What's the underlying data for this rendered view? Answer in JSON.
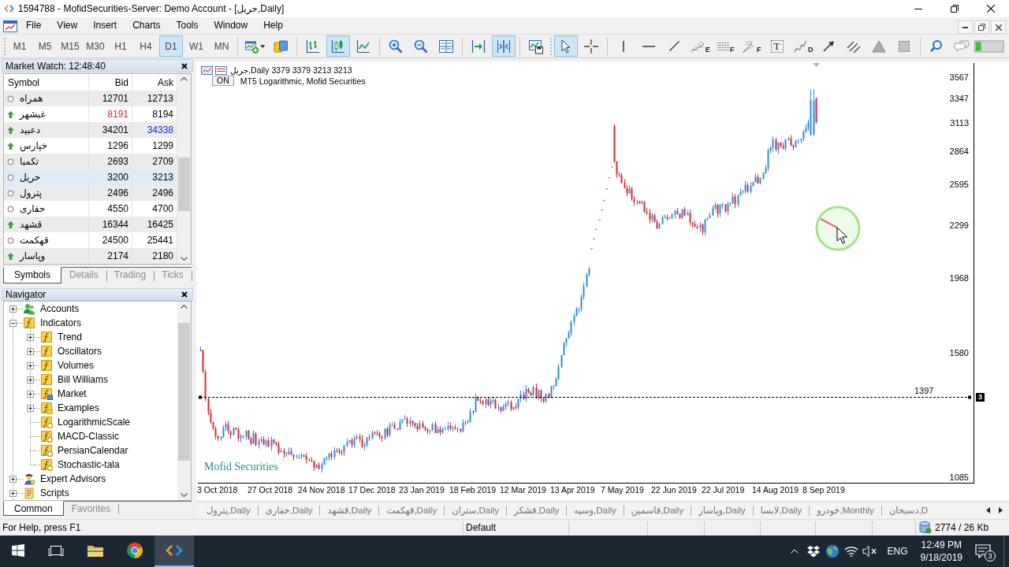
{
  "window": {
    "title": "1594788 - MofidSecurities-Server: Demo Account - [حریل,Daily]"
  },
  "menu": [
    "File",
    "View",
    "Insert",
    "Charts",
    "Tools",
    "Window",
    "Help"
  ],
  "toolbar": {
    "timeframes": [
      {
        "label": "M1",
        "selected": false
      },
      {
        "label": "M5",
        "selected": false
      },
      {
        "label": "M15",
        "selected": false
      },
      {
        "label": "M30",
        "selected": false
      },
      {
        "label": "H1",
        "selected": false
      },
      {
        "label": "H4",
        "selected": false
      },
      {
        "label": "D1",
        "selected": true
      },
      {
        "label": "W1",
        "selected": false
      },
      {
        "label": "MN",
        "selected": false
      }
    ],
    "tool_groups": [
      [
        {
          "kind": "new-chart",
          "selected": false
        },
        {
          "kind": "profiles",
          "selected": false
        }
      ],
      [
        {
          "kind": "bar-chart",
          "selected": false
        },
        {
          "kind": "candlesticks",
          "selected": true
        },
        {
          "kind": "line-chart",
          "selected": false
        }
      ],
      [
        {
          "kind": "zoom-in",
          "selected": false
        },
        {
          "kind": "zoom-out",
          "selected": false
        },
        {
          "kind": "tile",
          "selected": false
        }
      ],
      [
        {
          "kind": "chart-shift",
          "selected": false
        },
        {
          "kind": "auto-scroll",
          "selected": true
        }
      ],
      [
        {
          "kind": "templates",
          "selected": false
        }
      ],
      [
        {
          "kind": "cursor",
          "selected": true
        },
        {
          "kind": "crosshair",
          "selected": false
        }
      ],
      [
        {
          "kind": "vertical-line",
          "selected": false
        },
        {
          "kind": "horizontal-line",
          "selected": false
        },
        {
          "kind": "trendline",
          "selected": false
        },
        {
          "kind": "fibo-expansion",
          "selected": false,
          "letter": "E"
        },
        {
          "kind": "fibo-retracement",
          "selected": false,
          "letter": "F"
        },
        {
          "kind": "fibo-fan",
          "selected": false,
          "letter": "F"
        },
        {
          "kind": "text-label",
          "selected": false,
          "letter": "T"
        },
        {
          "kind": "wave",
          "selected": false,
          "letter": "D"
        },
        {
          "kind": "arrow",
          "selected": false
        },
        {
          "kind": "channel",
          "selected": false
        },
        {
          "kind": "triangle",
          "selected": false
        },
        {
          "kind": "rectangle",
          "selected": false
        }
      ],
      [
        {
          "kind": "search",
          "selected": false
        },
        {
          "kind": "chat",
          "selected": false
        }
      ]
    ]
  },
  "market_watch": {
    "title": "Market Watch: 12:48:40",
    "columns": [
      "Symbol",
      "Bid",
      "Ask"
    ],
    "rows": [
      {
        "symbol": "همراه",
        "kind": "unchanged",
        "bid": "12701",
        "ask": "12713",
        "bid_down": false,
        "ask_up": false,
        "selected": false
      },
      {
        "symbol": "غبشهر",
        "kind": "rising",
        "bid": "8191",
        "ask": "8194",
        "bid_down": true,
        "ask_up": false,
        "selected": false
      },
      {
        "symbol": "دعبید",
        "kind": "rising",
        "bid": "34201",
        "ask": "34338",
        "bid_down": false,
        "ask_up": true,
        "selected": false
      },
      {
        "symbol": "خپارس",
        "kind": "rising",
        "bid": "1296",
        "ask": "1299",
        "bid_down": false,
        "ask_up": false,
        "selected": false
      },
      {
        "symbol": "تکمبا",
        "kind": "unchanged",
        "bid": "2693",
        "ask": "2709",
        "bid_down": false,
        "ask_up": false,
        "selected": false
      },
      {
        "symbol": "حریل",
        "kind": "unchanged",
        "bid": "3200",
        "ask": "3213",
        "bid_down": false,
        "ask_up": false,
        "selected": true
      },
      {
        "symbol": "پترول",
        "kind": "unchanged",
        "bid": "2496",
        "ask": "2496",
        "bid_down": false,
        "ask_up": false,
        "selected": false
      },
      {
        "symbol": "حفاری",
        "kind": "unchanged",
        "bid": "4550",
        "ask": "4700",
        "bid_down": false,
        "ask_up": false,
        "selected": false
      },
      {
        "symbol": "قشهد",
        "kind": "rising",
        "bid": "16344",
        "ask": "16425",
        "bid_down": false,
        "ask_up": false,
        "selected": false
      },
      {
        "symbol": "قهکمت",
        "kind": "unchanged",
        "bid": "24500",
        "ask": "25441",
        "bid_down": false,
        "ask_up": false,
        "selected": false
      },
      {
        "symbol": "وپاسار",
        "kind": "rising",
        "bid": "2174",
        "ask": "2180",
        "bid_down": false,
        "ask_up": false,
        "selected": false
      }
    ],
    "tabs": [
      {
        "label": "Symbols",
        "selected": true
      },
      {
        "label": "Details",
        "selected": false
      },
      {
        "label": "Trading",
        "selected": false
      },
      {
        "label": "Ticks",
        "selected": false
      }
    ]
  },
  "navigator": {
    "title": "Navigator",
    "items": [
      {
        "label": "Accounts",
        "kind": "accounts",
        "expanded": false
      },
      {
        "label": "Indicators",
        "kind": "indicators",
        "expanded": true,
        "children": [
          {
            "label": "Trend",
            "kind": "indicators",
            "expanded": false
          },
          {
            "label": "Oscillators",
            "kind": "indicators",
            "expanded": false
          },
          {
            "label": "Volumes",
            "kind": "indicators",
            "expanded": false
          },
          {
            "label": "Bill Williams",
            "kind": "indicators",
            "expanded": false
          },
          {
            "label": "Market",
            "kind": "market",
            "expanded": false
          },
          {
            "label": "Examples",
            "kind": "examples",
            "expanded": false
          },
          {
            "label": "LogarithmicScale",
            "kind": "custom"
          },
          {
            "label": "MACD-Classic",
            "kind": "custom"
          },
          {
            "label": "PersianCalendar",
            "kind": "custom"
          },
          {
            "label": "Stochastic-tala",
            "kind": "custom"
          }
        ]
      },
      {
        "label": "Expert Advisors",
        "kind": "experts",
        "expanded": false
      },
      {
        "label": "Scripts",
        "kind": "scripts",
        "expanded": false
      }
    ],
    "tabs": [
      {
        "label": "Common",
        "selected": true
      },
      {
        "label": "Favorites",
        "selected": false
      }
    ]
  },
  "chart": {
    "symbol_period": "حریل,Daily",
    "ohlc": "3379 3379 3213 3213",
    "indicator_toggle": "ON",
    "indicator_label": "MT5 Logarithmic, Mofid Securities",
    "broker_label": "Mofid Securities",
    "price_labels": [
      "3567",
      "3347",
      "3113",
      "2864",
      "2595",
      "2299",
      "1968",
      "1580",
      "1085"
    ],
    "time_labels": [
      "3 Oct 2018",
      "27 Oct 2018",
      "24 Nov 2018",
      "17 Dec 2018",
      "23 Jan 2019",
      "18 Feb 2019",
      "12 Mar 2019",
      "13 Apr 2019",
      "7 May 2019",
      "22 Jun 2019",
      "22 Jul 2019",
      "14 Aug 2019",
      "8 Sep 2019"
    ],
    "price_line": {
      "label": "1397",
      "marker": "3"
    }
  },
  "chart_tabs": {
    "tabs": [
      {
        "label": "پترول,Daily",
        "selected": false
      },
      {
        "label": "حفاری,Daily",
        "selected": false
      },
      {
        "label": "قشهد,Daily",
        "selected": false
      },
      {
        "label": "قهکمت,Daily",
        "selected": false
      },
      {
        "label": "ستران,Daily",
        "selected": false
      },
      {
        "label": "قشکر,Daily",
        "selected": false
      },
      {
        "label": "وسپه,Daily",
        "selected": false
      },
      {
        "label": "فاسمین,Daily",
        "selected": false
      },
      {
        "label": "وپاسار,Daily",
        "selected": false
      },
      {
        "label": "لابسا,Daily",
        "selected": false
      },
      {
        "label": "خودرو,Monthly",
        "selected": false
      },
      {
        "label": "دسبحان,D",
        "selected": false
      }
    ]
  },
  "status_bar": {
    "help": "For Help, press F1",
    "profile": "Default",
    "traffic": "2774 / 26 Kb"
  },
  "taskbar": {
    "apps": [
      {
        "kind": "file-explorer",
        "active": false
      },
      {
        "kind": "browser",
        "active": false
      },
      {
        "kind": "terminal",
        "active": true
      }
    ],
    "language": "ENG",
    "time": "12:49 PM",
    "date": "9/18/2019",
    "notifications": "3"
  }
}
